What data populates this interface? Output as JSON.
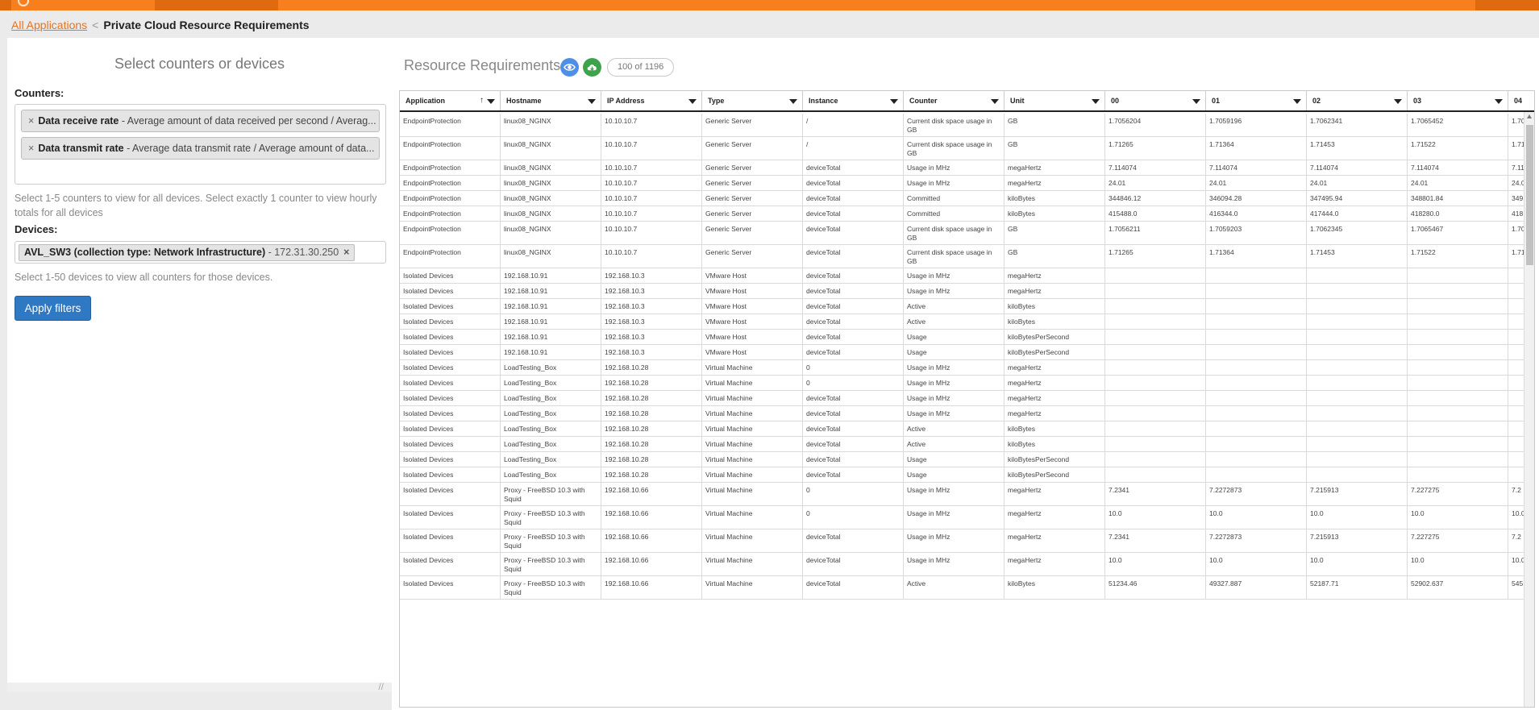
{
  "breadcrumb": {
    "root": "All Applications",
    "separator": "<",
    "current": "Private Cloud Resource Requirements"
  },
  "left_panel": {
    "title": "Select counters or devices",
    "counters_label": "Counters:",
    "counters": [
      {
        "name": "Data receive rate",
        "desc": " - Average amount of data received per second / Averag..."
      },
      {
        "name": "Data transmit rate",
        "desc": " - Average data transmit rate / Average amount of data..."
      }
    ],
    "counters_hint": "Select 1-5 counters to view for all devices. Select exactly 1 counter to view hourly totals for all devices",
    "devices_label": "Devices:",
    "device": {
      "name": "AVL_SW3 (collection type: Network Infrastructure)",
      "ip": " - 172.31.30.250"
    },
    "devices_hint": "Select 1-50 devices to view all counters for those devices.",
    "apply_label": "Apply filters"
  },
  "right_panel": {
    "title": "Resource Requirements",
    "count": "100 of 1196",
    "icons": {
      "view": "eye-icon",
      "download": "cloud-download-icon"
    },
    "columns": [
      "Application",
      "Hostname",
      "IP Address",
      "Type",
      "Instance",
      "Counter",
      "Unit",
      "00",
      "01",
      "02",
      "03",
      "04"
    ],
    "sort_indicator": "↑",
    "rows": [
      [
        "EndpointProtection",
        "linux08_NGINX",
        "10.10.10.7",
        "Generic Server",
        "/",
        "Current disk space usage in GB",
        "GB",
        "1.7056204",
        "1.7059196",
        "1.7062341",
        "1.7065452",
        "1.70"
      ],
      [
        "EndpointProtection",
        "linux08_NGINX",
        "10.10.10.7",
        "Generic Server",
        "/",
        "Current disk space usage in GB",
        "GB",
        "1.71265",
        "1.71364",
        "1.71453",
        "1.71522",
        "1.71"
      ],
      [
        "EndpointProtection",
        "linux08_NGINX",
        "10.10.10.7",
        "Generic Server",
        "deviceTotal",
        "Usage in MHz",
        "megaHertz",
        "7.114074",
        "7.114074",
        "7.114074",
        "7.114074",
        "7.11"
      ],
      [
        "EndpointProtection",
        "linux08_NGINX",
        "10.10.10.7",
        "Generic Server",
        "deviceTotal",
        "Usage in MHz",
        "megaHertz",
        "24.01",
        "24.01",
        "24.01",
        "24.01",
        "24.0"
      ],
      [
        "EndpointProtection",
        "linux08_NGINX",
        "10.10.10.7",
        "Generic Server",
        "deviceTotal",
        "Committed",
        "kiloBytes",
        "344846.12",
        "346094.28",
        "347495.94",
        "348801.84",
        "349"
      ],
      [
        "EndpointProtection",
        "linux08_NGINX",
        "10.10.10.7",
        "Generic Server",
        "deviceTotal",
        "Committed",
        "kiloBytes",
        "415488.0",
        "416344.0",
        "417444.0",
        "418280.0",
        "418"
      ],
      [
        "EndpointProtection",
        "linux08_NGINX",
        "10.10.10.7",
        "Generic Server",
        "deviceTotal",
        "Current disk space usage in GB",
        "GB",
        "1.7056211",
        "1.7059203",
        "1.7062345",
        "1.7065467",
        "1.70"
      ],
      [
        "EndpointProtection",
        "linux08_NGINX",
        "10.10.10.7",
        "Generic Server",
        "deviceTotal",
        "Current disk space usage in GB",
        "GB",
        "1.71265",
        "1.71364",
        "1.71453",
        "1.71522",
        "1.71"
      ],
      [
        "Isolated Devices",
        "192.168.10.91",
        "192.168.10.3",
        "VMware Host",
        "deviceTotal",
        "Usage in MHz",
        "megaHertz",
        "",
        "",
        "",
        "",
        ""
      ],
      [
        "Isolated Devices",
        "192.168.10.91",
        "192.168.10.3",
        "VMware Host",
        "deviceTotal",
        "Usage in MHz",
        "megaHertz",
        "",
        "",
        "",
        "",
        ""
      ],
      [
        "Isolated Devices",
        "192.168.10.91",
        "192.168.10.3",
        "VMware Host",
        "deviceTotal",
        "Active",
        "kiloBytes",
        "",
        "",
        "",
        "",
        ""
      ],
      [
        "Isolated Devices",
        "192.168.10.91",
        "192.168.10.3",
        "VMware Host",
        "deviceTotal",
        "Active",
        "kiloBytes",
        "",
        "",
        "",
        "",
        ""
      ],
      [
        "Isolated Devices",
        "192.168.10.91",
        "192.168.10.3",
        "VMware Host",
        "deviceTotal",
        "Usage",
        "kiloBytesPerSecond",
        "",
        "",
        "",
        "",
        ""
      ],
      [
        "Isolated Devices",
        "192.168.10.91",
        "192.168.10.3",
        "VMware Host",
        "deviceTotal",
        "Usage",
        "kiloBytesPerSecond",
        "",
        "",
        "",
        "",
        ""
      ],
      [
        "Isolated Devices",
        "LoadTesting_Box",
        "192.168.10.28",
        "Virtual Machine",
        "0",
        "Usage in MHz",
        "megaHertz",
        "",
        "",
        "",
        "",
        ""
      ],
      [
        "Isolated Devices",
        "LoadTesting_Box",
        "192.168.10.28",
        "Virtual Machine",
        "0",
        "Usage in MHz",
        "megaHertz",
        "",
        "",
        "",
        "",
        ""
      ],
      [
        "Isolated Devices",
        "LoadTesting_Box",
        "192.168.10.28",
        "Virtual Machine",
        "deviceTotal",
        "Usage in MHz",
        "megaHertz",
        "",
        "",
        "",
        "",
        ""
      ],
      [
        "Isolated Devices",
        "LoadTesting_Box",
        "192.168.10.28",
        "Virtual Machine",
        "deviceTotal",
        "Usage in MHz",
        "megaHertz",
        "",
        "",
        "",
        "",
        ""
      ],
      [
        "Isolated Devices",
        "LoadTesting_Box",
        "192.168.10.28",
        "Virtual Machine",
        "deviceTotal",
        "Active",
        "kiloBytes",
        "",
        "",
        "",
        "",
        ""
      ],
      [
        "Isolated Devices",
        "LoadTesting_Box",
        "192.168.10.28",
        "Virtual Machine",
        "deviceTotal",
        "Active",
        "kiloBytes",
        "",
        "",
        "",
        "",
        ""
      ],
      [
        "Isolated Devices",
        "LoadTesting_Box",
        "192.168.10.28",
        "Virtual Machine",
        "deviceTotal",
        "Usage",
        "kiloBytesPerSecond",
        "",
        "",
        "",
        "",
        ""
      ],
      [
        "Isolated Devices",
        "LoadTesting_Box",
        "192.168.10.28",
        "Virtual Machine",
        "deviceTotal",
        "Usage",
        "kiloBytesPerSecond",
        "",
        "",
        "",
        "",
        ""
      ],
      [
        "Isolated Devices",
        "Proxy - FreeBSD 10.3 with Squid",
        "192.168.10.66",
        "Virtual Machine",
        "0",
        "Usage in MHz",
        "megaHertz",
        "7.2341",
        "7.2272873",
        "7.215913",
        "7.227275",
        "7.2"
      ],
      [
        "Isolated Devices",
        "Proxy - FreeBSD 10.3 with Squid",
        "192.168.10.66",
        "Virtual Machine",
        "0",
        "Usage in MHz",
        "megaHertz",
        "10.0",
        "10.0",
        "10.0",
        "10.0",
        "10.0"
      ],
      [
        "Isolated Devices",
        "Proxy - FreeBSD 10.3 with Squid",
        "192.168.10.66",
        "Virtual Machine",
        "deviceTotal",
        "Usage in MHz",
        "megaHertz",
        "7.2341",
        "7.2272873",
        "7.215913",
        "7.227275",
        "7.2"
      ],
      [
        "Isolated Devices",
        "Proxy - FreeBSD 10.3 with Squid",
        "192.168.10.66",
        "Virtual Machine",
        "deviceTotal",
        "Usage in MHz",
        "megaHertz",
        "10.0",
        "10.0",
        "10.0",
        "10.0",
        "10.0"
      ],
      [
        "Isolated Devices",
        "Proxy - FreeBSD 10.3 with Squid",
        "192.168.10.66",
        "Virtual Machine",
        "deviceTotal",
        "Active",
        "kiloBytes",
        "51234.46",
        "49327.887",
        "52187.71",
        "52902.637",
        "545"
      ]
    ]
  }
}
